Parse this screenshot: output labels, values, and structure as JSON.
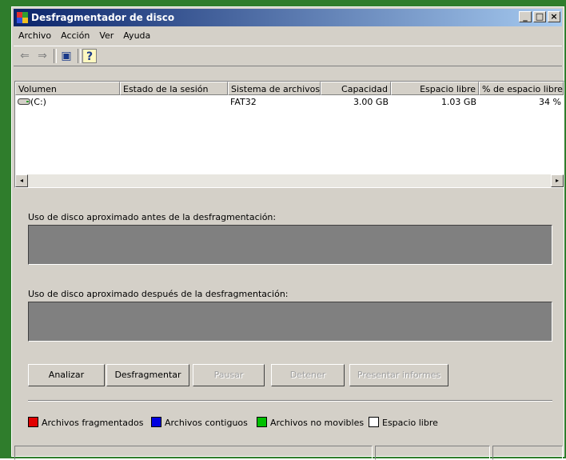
{
  "window": {
    "title": "Desfragmentador de disco",
    "min_glyph": "_",
    "max_glyph": "□",
    "close_glyph": "×"
  },
  "menu": [
    "Archivo",
    "Acción",
    "Ver",
    "Ayuda"
  ],
  "toolbar": {
    "back_glyph": "⇐",
    "forward_glyph": "⇒",
    "view_glyph": "▣",
    "help_glyph": "?"
  },
  "columns": [
    "Volumen",
    "Estado de la sesión",
    "Sistema de archivos",
    "Capacidad",
    "Espacio libre",
    "% de espacio libre"
  ],
  "rows": [
    {
      "volume": "(C:)",
      "session_state": "",
      "file_system": "FAT32",
      "capacity": "3.00 GB",
      "free_space": "1.03 GB",
      "percent_free": "34 %"
    }
  ],
  "scroll": {
    "left_glyph": "◂",
    "right_glyph": "▸"
  },
  "usage": {
    "before_label": "Uso de disco aproximado antes de la desfragmentación:",
    "after_label": "Uso de disco aproximado después de la desfragmentación:"
  },
  "buttons": {
    "analyze": "Analizar",
    "defragment": "Desfragmentar",
    "pause": "Pausar",
    "stop": "Detener",
    "report": "Presentar informes"
  },
  "legend": [
    {
      "label": "Archivos fragmentados",
      "color": "#e00000"
    },
    {
      "label": "Archivos contiguos",
      "color": "#0000e0"
    },
    {
      "label": "Archivos no movibles",
      "color": "#00c000"
    },
    {
      "label": "Espacio libre",
      "color": "#ffffff"
    }
  ],
  "colors": {
    "title_start": "#0a246a",
    "title_end": "#a6caf0",
    "face": "#d4d0c8",
    "disk_bar": "#808080",
    "frame": "#2f7d2c"
  }
}
